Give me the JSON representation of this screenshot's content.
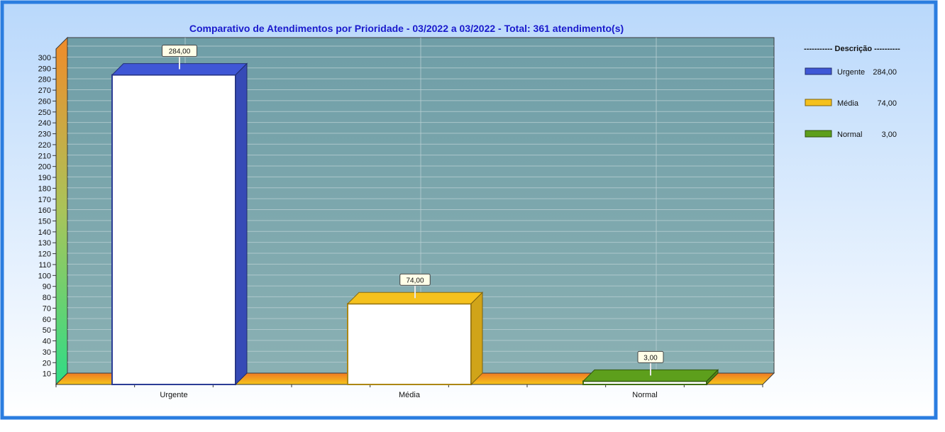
{
  "chart_data": {
    "type": "bar",
    "title": "Comparativo  de  Atendimentos  por  Prioridade  -  03/2022  a  03/2022  -  Total:  361  atendimento(s)",
    "categories": [
      "Urgente",
      "Média",
      "Normal"
    ],
    "values": [
      284,
      74,
      3
    ],
    "value_labels": [
      "284,00",
      "74,00",
      "3,00"
    ],
    "ylim": [
      0,
      300
    ],
    "ytick_step": 10,
    "xlabel": "",
    "ylabel": "",
    "grid": true,
    "legend_position": "right",
    "legend": {
      "header": "----------- Descrição ----------",
      "items": [
        {
          "label": "Urgente",
          "value": "284,00"
        },
        {
          "label": "Média",
          "value": "74,00"
        },
        {
          "label": "Normal",
          "value": "3,00"
        }
      ]
    },
    "colors": {
      "Urgente": "#3f57d6",
      "Média": "#f5c11d",
      "Normal": "#5d9f1c",
      "plot_bg": "#7aa6ae",
      "title": "#1a1acc",
      "frame": "#2b7de0"
    }
  }
}
